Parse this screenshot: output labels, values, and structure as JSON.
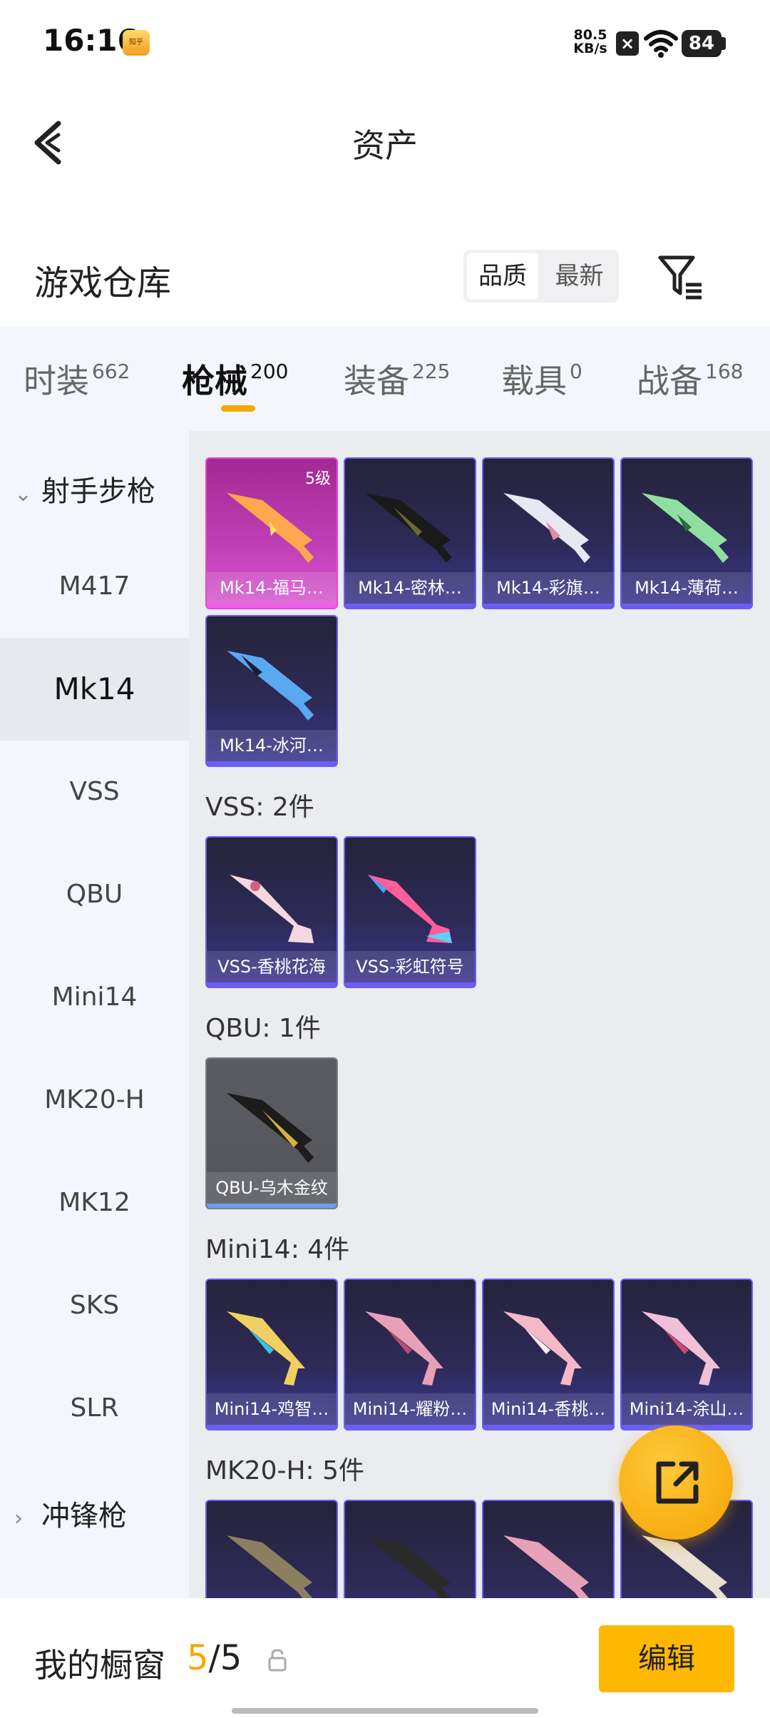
{
  "status": {
    "time": "16:16",
    "app_badge": "知乎",
    "net_speed_value": "80.5",
    "net_speed_unit": "KB/s",
    "battery": "84"
  },
  "header": {
    "title": "资产"
  },
  "warehouse": {
    "title": "游戏仓库",
    "sort_options": [
      "品质",
      "最新"
    ],
    "selected_sort": "品质"
  },
  "tabs": [
    {
      "label": "时装",
      "count": "662"
    },
    {
      "label": "枪械",
      "count": "200",
      "active": true
    },
    {
      "label": "装备",
      "count": "225"
    },
    {
      "label": "载具",
      "count": "0"
    },
    {
      "label": "战备",
      "count": "168"
    }
  ],
  "sidebar": {
    "category": "射手步枪",
    "items": [
      "M417",
      "Mk14",
      "VSS",
      "QBU",
      "Mini14",
      "MK20-H",
      "MK12",
      "SKS",
      "SLR"
    ],
    "active_item": "Mk14",
    "next_category": "冲锋枪"
  },
  "sections": {
    "mk14_cards": [
      {
        "label": "Mk14-福马…",
        "level": "5级"
      },
      {
        "label": "Mk14-密林…"
      },
      {
        "label": "Mk14-彩旗…"
      },
      {
        "label": "Mk14-薄荷…"
      },
      {
        "label": "Mk14-冰河…"
      }
    ],
    "vss_title": "VSS: 2件",
    "vss_cards": [
      "VSS-香桃花海",
      "VSS-彩虹符号"
    ],
    "qbu_title": "QBU: 1件",
    "qbu_cards": [
      "QBU-乌木金纹"
    ],
    "mini14_title": "Mini14: 4件",
    "mini14_cards": [
      "Mini14-鸡智…",
      "Mini14-耀粉…",
      "Mini14-香桃…",
      "Mini14-涂山…"
    ],
    "mk20_title": "MK20-H: 5件"
  },
  "bottom": {
    "showcase_label": "我的橱窗",
    "current": "5",
    "total": "/5",
    "edit_label": "编辑"
  },
  "colors": {
    "accent": "#f5a700",
    "card_border": "#6b5ef0",
    "gold_card": "#c23fb8"
  }
}
